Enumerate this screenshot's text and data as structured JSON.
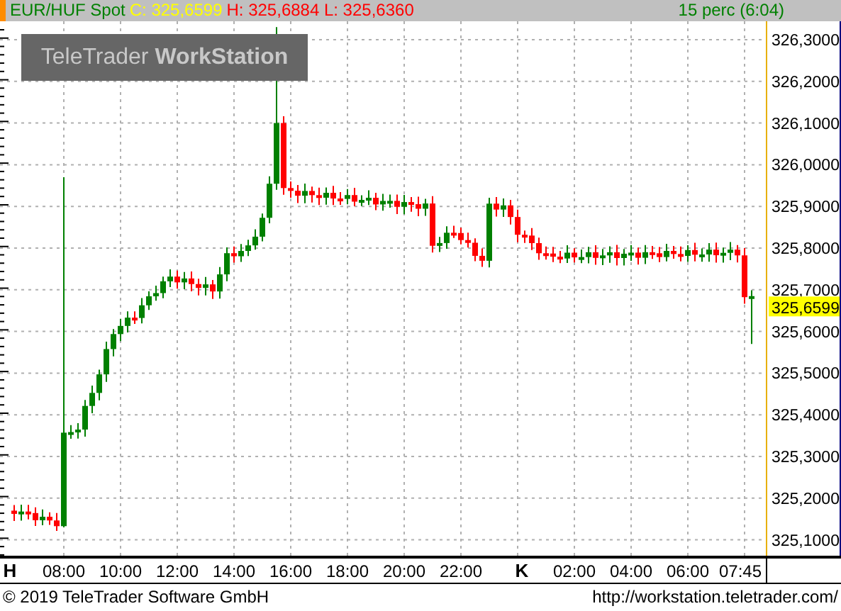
{
  "header": {
    "symbol": "EUR/HUF Spot",
    "close": "C: 325,6599",
    "high_low": "H: 325,6884 L: 325,6360",
    "interval": "15 perc (6:04)"
  },
  "logo": {
    "name": "TeleTrader",
    "product": "WorkStation"
  },
  "price_axis": {
    "labels": [
      "326,3000",
      "326,2000",
      "326,1000",
      "326,0000",
      "325,9000",
      "325,8000",
      "325,7000",
      "325,6000",
      "325,5000",
      "325,4000",
      "325,3000",
      "325,2000",
      "325,1000"
    ],
    "last_price": "325,6599"
  },
  "time_axis": {
    "labels": [
      {
        "text": "H",
        "kind": "day"
      },
      {
        "text": "08:00",
        "kind": "time"
      },
      {
        "text": "10:00",
        "kind": "time"
      },
      {
        "text": "12:00",
        "kind": "time"
      },
      {
        "text": "14:00",
        "kind": "time"
      },
      {
        "text": "16:00",
        "kind": "time"
      },
      {
        "text": "18:00",
        "kind": "time"
      },
      {
        "text": "20:00",
        "kind": "time"
      },
      {
        "text": "22:00",
        "kind": "time"
      },
      {
        "text": "K",
        "kind": "day"
      },
      {
        "text": "02:00",
        "kind": "time"
      },
      {
        "text": "04:00",
        "kind": "time"
      },
      {
        "text": "06:00",
        "kind": "time"
      },
      {
        "text": "07:45",
        "kind": "time"
      }
    ]
  },
  "footer": {
    "copyright": "© 2019 TeleTrader Software GmbH",
    "url": "http://workstation.teletrader.com/"
  }
}
